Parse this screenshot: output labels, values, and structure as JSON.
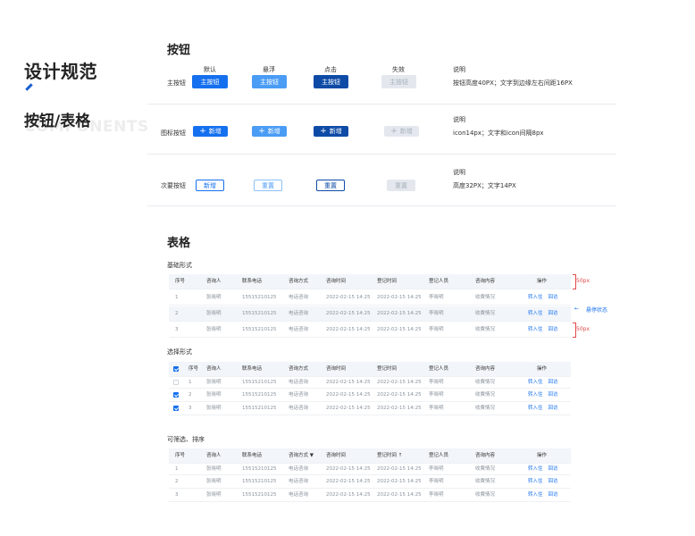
{
  "left": {
    "title": "设计规范",
    "subtitle": "按钮/表格",
    "ghost": "COMPONENTS"
  },
  "buttons_section": {
    "title": "按钮",
    "columns": [
      "默认",
      "悬浮",
      "点击",
      "失效",
      "说明"
    ],
    "rows": [
      {
        "label": "主按钮",
        "button_text": "主按钮",
        "desc_head": "说明",
        "desc": "按钮高度40PX；文字到边缘左右间距16PX"
      },
      {
        "label": "图标按钮",
        "button_text": "新增",
        "desc_head": "说明",
        "desc": "icon14px；文字和icon间隔8px"
      },
      {
        "label": "次要按钮",
        "button_text_default": "新增",
        "button_text_other": "重置",
        "desc_head": "说明",
        "desc": "高度32PX；文字14PX"
      }
    ]
  },
  "table_section": {
    "title": "表格",
    "basic_title": "基础形式",
    "select_title": "选择形式",
    "filter_title": "可筛选、排序",
    "headers": [
      "序号",
      "咨询人",
      "联系电话",
      "咨询方式",
      "咨询时间",
      "登记时间",
      "登记人员",
      "咨询内容",
      "操作"
    ],
    "filter_headers": [
      "序号",
      "咨询人",
      "联系电话",
      "咨询方式 ▼",
      "咨询时间",
      "登记时间 ↑",
      "登记人员",
      "咨询内容",
      "操作"
    ],
    "rows": [
      {
        "no": "1",
        "name": "张晓明",
        "phone": "15515210125",
        "method": "电话咨询",
        "consult_time": "2022-02-15 14:25",
        "reg_time": "2022-02-15 14:25",
        "staff": "李晓明",
        "content": "收費情况",
        "op1": "转入住",
        "op2": "回访"
      },
      {
        "no": "2",
        "name": "张晓明",
        "phone": "15515210125",
        "method": "电话咨询",
        "consult_time": "2022-02-15 14:25",
        "reg_time": "2022-02-15 14:25",
        "staff": "李晓明",
        "content": "收費情况",
        "op1": "转入住",
        "op2": "回访"
      },
      {
        "no": "3",
        "name": "张晓明",
        "phone": "15515210125",
        "method": "电话咨询",
        "consult_time": "2022-02-15 14:25",
        "reg_time": "2022-02-15 14:25",
        "staff": "李晓明",
        "content": "收費情况",
        "op1": "转入住",
        "op2": "回访"
      }
    ],
    "select_checked": [
      true,
      false,
      true,
      true
    ],
    "annotations": {
      "row_height_1": "50px",
      "row_height_2": "50px",
      "hover_state": "悬停状态"
    }
  }
}
